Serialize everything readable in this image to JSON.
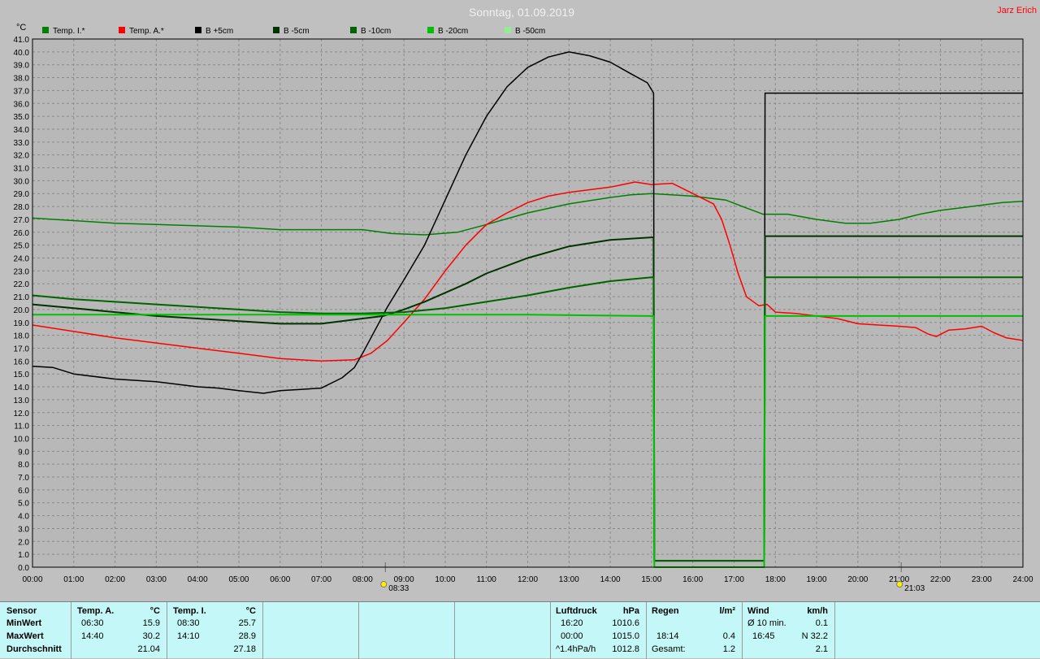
{
  "header": {
    "title": "Sonntag, 01.09.2019",
    "author": "Jarz Erich",
    "unit": "°C"
  },
  "chart_data": {
    "type": "line",
    "title": "Sonntag, 01.09.2019",
    "ylabel": "°C",
    "xlim": [
      0,
      24
    ],
    "ylim": [
      0,
      41
    ],
    "grid": true,
    "legend_position": "top-left",
    "x_ticks": [
      "00:00",
      "01:00",
      "02:00",
      "03:00",
      "04:00",
      "05:00",
      "06:00",
      "07:00",
      "08:00",
      "09:00",
      "10:00",
      "11:00",
      "12:00",
      "13:00",
      "14:00",
      "15:00",
      "16:00",
      "17:00",
      "18:00",
      "19:00",
      "20:00",
      "21:00",
      "22:00",
      "23:00",
      "24:00"
    ],
    "y_ticks": [
      "0.0",
      "1.0",
      "2.0",
      "3.0",
      "4.0",
      "5.0",
      "6.0",
      "7.0",
      "8.0",
      "9.0",
      "10.0",
      "11.0",
      "12.0",
      "13.0",
      "14.0",
      "15.0",
      "16.0",
      "17.0",
      "18.0",
      "19.0",
      "20.0",
      "21.0",
      "22.0",
      "23.0",
      "24.0",
      "25.0",
      "26.0",
      "27.0",
      "28.0",
      "29.0",
      "30.0",
      "31.0",
      "32.0",
      "33.0",
      "34.0",
      "35.0",
      "36.0",
      "37.0",
      "38.0",
      "39.0",
      "40.0",
      "41.0"
    ],
    "annotations": [
      {
        "label": "08:33",
        "x": 8.55,
        "icon": "sunrise-icon"
      },
      {
        "label": "21:03",
        "x": 21.05,
        "icon": "sunset-icon"
      }
    ],
    "series": [
      {
        "name": "Temp. I.*",
        "color": "#008000",
        "width": 1.5,
        "points": [
          [
            0,
            27.1
          ],
          [
            1,
            26.9
          ],
          [
            2,
            26.7
          ],
          [
            3,
            26.6
          ],
          [
            4,
            26.5
          ],
          [
            5,
            26.4
          ],
          [
            6,
            26.2
          ],
          [
            7,
            26.2
          ],
          [
            8,
            26.2
          ],
          [
            8.7,
            25.9
          ],
          [
            9.5,
            25.8
          ],
          [
            10.3,
            26.0
          ],
          [
            11,
            26.6
          ],
          [
            12,
            27.5
          ],
          [
            13,
            28.2
          ],
          [
            14,
            28.7
          ],
          [
            14.5,
            28.9
          ],
          [
            15,
            29.0
          ],
          [
            16,
            28.8
          ],
          [
            16.8,
            28.5
          ],
          [
            17.2,
            28.0
          ],
          [
            17.7,
            27.4
          ],
          [
            18.3,
            27.4
          ],
          [
            19,
            27.0
          ],
          [
            19.7,
            26.7
          ],
          [
            20.3,
            26.7
          ],
          [
            21,
            27.0
          ],
          [
            21.5,
            27.4
          ],
          [
            22,
            27.7
          ],
          [
            22.5,
            27.9
          ],
          [
            23,
            28.1
          ],
          [
            23.5,
            28.3
          ],
          [
            24,
            28.4
          ]
        ]
      },
      {
        "name": "Temp. A.*",
        "color": "#ff0000",
        "width": 1.5,
        "points": [
          [
            0,
            18.8
          ],
          [
            1,
            18.3
          ],
          [
            2,
            17.8
          ],
          [
            3,
            17.4
          ],
          [
            4,
            17.0
          ],
          [
            5,
            16.6
          ],
          [
            6,
            16.2
          ],
          [
            7,
            16.0
          ],
          [
            7.8,
            16.1
          ],
          [
            8.2,
            16.6
          ],
          [
            8.6,
            17.6
          ],
          [
            9,
            19.0
          ],
          [
            9.5,
            20.8
          ],
          [
            10,
            23.0
          ],
          [
            10.5,
            25.0
          ],
          [
            11,
            26.6
          ],
          [
            11.5,
            27.5
          ],
          [
            12,
            28.3
          ],
          [
            12.5,
            28.8
          ],
          [
            13,
            29.1
          ],
          [
            13.5,
            29.3
          ],
          [
            14,
            29.5
          ],
          [
            14.6,
            29.9
          ],
          [
            15,
            29.7
          ],
          [
            15.5,
            29.8
          ],
          [
            16,
            29.0
          ],
          [
            16.5,
            28.2
          ],
          [
            16.7,
            27.0
          ],
          [
            16.9,
            25.0
          ],
          [
            17.1,
            22.8
          ],
          [
            17.3,
            21.0
          ],
          [
            17.6,
            20.3
          ],
          [
            17.8,
            20.4
          ],
          [
            18,
            19.8
          ],
          [
            18.5,
            19.7
          ],
          [
            19,
            19.5
          ],
          [
            19.5,
            19.3
          ],
          [
            20,
            18.9
          ],
          [
            20.5,
            18.8
          ],
          [
            21,
            18.7
          ],
          [
            21.4,
            18.6
          ],
          [
            21.7,
            18.1
          ],
          [
            21.9,
            17.9
          ],
          [
            22.2,
            18.4
          ],
          [
            22.6,
            18.5
          ],
          [
            23,
            18.7
          ],
          [
            23.3,
            18.2
          ],
          [
            23.6,
            17.8
          ],
          [
            24,
            17.6
          ]
        ]
      },
      {
        "name": "B +5cm",
        "color": "#000000",
        "width": 1.5,
        "points": [
          [
            0,
            15.6
          ],
          [
            0.5,
            15.5
          ],
          [
            1,
            15.0
          ],
          [
            2,
            14.6
          ],
          [
            3,
            14.4
          ],
          [
            4,
            14.0
          ],
          [
            4.5,
            13.9
          ],
          [
            5,
            13.7
          ],
          [
            5.6,
            13.5
          ],
          [
            6,
            13.7
          ],
          [
            6.5,
            13.8
          ],
          [
            7,
            13.9
          ],
          [
            7.5,
            14.7
          ],
          [
            7.8,
            15.5
          ],
          [
            8,
            16.6
          ],
          [
            8.3,
            18.4
          ],
          [
            8.6,
            20.2
          ],
          [
            9,
            22.3
          ],
          [
            9.5,
            25.0
          ],
          [
            10,
            28.5
          ],
          [
            10.5,
            32.0
          ],
          [
            11,
            35.0
          ],
          [
            11.5,
            37.3
          ],
          [
            12,
            38.8
          ],
          [
            12.5,
            39.6
          ],
          [
            13,
            40.0
          ],
          [
            13.5,
            39.7
          ],
          [
            14,
            39.2
          ],
          [
            14.5,
            38.3
          ],
          [
            14.9,
            37.6
          ],
          [
            15.05,
            36.8
          ],
          [
            15.07,
            0.5
          ],
          [
            17.73,
            0.5
          ],
          [
            17.75,
            36.8
          ],
          [
            24,
            36.8
          ]
        ]
      },
      {
        "name": "B -5cm",
        "color": "#003300",
        "width": 2,
        "points": [
          [
            0,
            20.4
          ],
          [
            1,
            20.1
          ],
          [
            2,
            19.8
          ],
          [
            3,
            19.5
          ],
          [
            4,
            19.3
          ],
          [
            5,
            19.1
          ],
          [
            6,
            18.9
          ],
          [
            7,
            18.9
          ],
          [
            8,
            19.3
          ],
          [
            8.5,
            19.5
          ],
          [
            9,
            20.0
          ],
          [
            9.5,
            20.6
          ],
          [
            10,
            21.3
          ],
          [
            10.5,
            22.0
          ],
          [
            11,
            22.8
          ],
          [
            12,
            24.0
          ],
          [
            13,
            24.9
          ],
          [
            14,
            25.4
          ],
          [
            15,
            25.6
          ],
          [
            15.05,
            25.6
          ],
          [
            15.07,
            0.5
          ],
          [
            17.73,
            0.5
          ],
          [
            17.75,
            25.7
          ],
          [
            24,
            25.7
          ]
        ]
      },
      {
        "name": "B -10cm",
        "color": "#006400",
        "width": 2,
        "points": [
          [
            0,
            21.1
          ],
          [
            1,
            20.8
          ],
          [
            2,
            20.6
          ],
          [
            3,
            20.4
          ],
          [
            4,
            20.2
          ],
          [
            5,
            20.0
          ],
          [
            6,
            19.8
          ],
          [
            7,
            19.7
          ],
          [
            8,
            19.7
          ],
          [
            9,
            19.8
          ],
          [
            10,
            20.1
          ],
          [
            11,
            20.6
          ],
          [
            12,
            21.1
          ],
          [
            13,
            21.7
          ],
          [
            14,
            22.2
          ],
          [
            15,
            22.5
          ],
          [
            15.05,
            22.5
          ],
          [
            15.07,
            0.5
          ],
          [
            17.73,
            0.5
          ],
          [
            17.75,
            22.5
          ],
          [
            24,
            22.5
          ]
        ]
      },
      {
        "name": "B -20cm",
        "color": "#00c000",
        "width": 2,
        "points": [
          [
            0,
            19.6
          ],
          [
            5,
            19.6
          ],
          [
            8,
            19.6
          ],
          [
            12,
            19.6
          ],
          [
            15,
            19.5
          ],
          [
            15.05,
            19.5
          ],
          [
            15.07,
            0
          ],
          [
            15.2,
            0
          ],
          [
            17.6,
            0
          ],
          [
            17.73,
            0
          ],
          [
            17.75,
            19.5
          ],
          [
            24,
            19.5
          ]
        ]
      },
      {
        "name": "B -50cm",
        "color": "#90ee90",
        "width": 1.5,
        "points": []
      }
    ]
  },
  "stats": {
    "sensor": {
      "label": "Sensor",
      "min": "MinWert",
      "max": "MaxWert",
      "avg": "Durchschnitt"
    },
    "temp_a": {
      "label": "Temp. A.",
      "unit": "°C",
      "min_time": "06:30",
      "min": "15.9",
      "max_time": "14:40",
      "max": "30.2",
      "avg": "21.04"
    },
    "temp_i": {
      "label": "Temp. I.",
      "unit": "°C",
      "min_time": "08:30",
      "min": "25.7",
      "max_time": "14:10",
      "max": "28.9",
      "avg": "27.18"
    },
    "pressure": {
      "label": "Luftdruck",
      "unit": "hPa",
      "min_time": "16:20",
      "min": "1010.6",
      "max_time": "00:00",
      "max": "1015.0",
      "trend_label": "^1.4hPa/h",
      "avg": "1012.8"
    },
    "rain": {
      "label": "Regen",
      "unit": "l/m²",
      "time": "18:14",
      "value": "0.4",
      "total_label": "Gesamt:",
      "total": "1.2"
    },
    "wind": {
      "label": "Wind",
      "unit": "km/h",
      "avg_label": "Ø 10 min.",
      "avg": "0.1",
      "gust_time": "16:45",
      "gust": "N 32.2",
      "day_avg": "2.1"
    }
  }
}
